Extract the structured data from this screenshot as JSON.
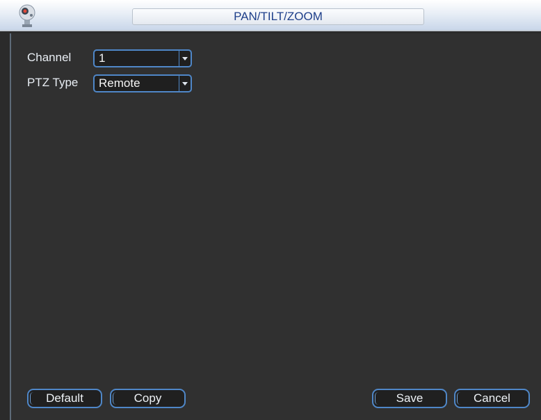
{
  "window": {
    "title": "PAN/TILT/ZOOM",
    "icon": "camera-logo-icon"
  },
  "form": {
    "channel": {
      "label": "Channel",
      "value": "1"
    },
    "ptz_type": {
      "label": "PTZ Type",
      "value": "Remote"
    }
  },
  "buttons": {
    "default": "Default",
    "copy": "Copy",
    "save": "Save",
    "cancel": "Cancel"
  },
  "colors": {
    "accent": "#4f87c8",
    "background": "#303030",
    "title_text": "#1e3f8a"
  }
}
